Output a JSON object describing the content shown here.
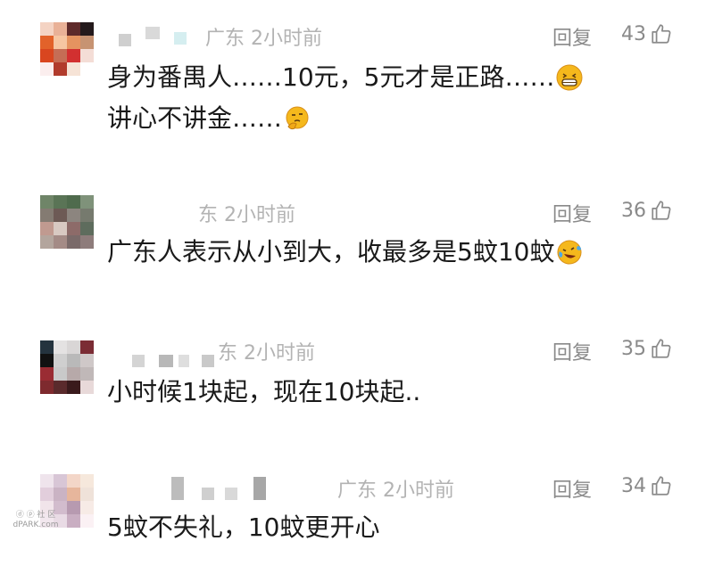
{
  "comments": [
    {
      "location_time": "广东 2小时前",
      "reply_label": "回复",
      "likes": "43",
      "lines": [
        "身为番禺人……10元，5元才是正路……",
        "讲心不讲金……"
      ],
      "emojis": [
        "grin-emoji",
        "thinking-emoji"
      ]
    },
    {
      "location_time": "东 2小时前",
      "reply_label": "回复",
      "likes": "36",
      "lines": [
        "广东人表示从小到大，收最多是5蚊10蚊"
      ],
      "emojis": [
        "laugh-cry-emoji"
      ]
    },
    {
      "location_time": "东 2小时前",
      "reply_label": "回复",
      "likes": "35",
      "lines": [
        "小时候1块起，现在10块起.."
      ],
      "emojis": []
    },
    {
      "location_time": "广东 2小时前",
      "reply_label": "回复",
      "likes": "34",
      "lines": [
        "5蚊不失礼，10蚊更开心"
      ],
      "emojis": []
    }
  ],
  "watermark": {
    "line1": "ⓓ ⓟ 社 区",
    "line2": "dPARK.com"
  },
  "colors": {
    "meta": "#b3b3b3",
    "action": "#8a8a8a",
    "text": "#1a1a1a",
    "emoji": "#f5b81c"
  }
}
